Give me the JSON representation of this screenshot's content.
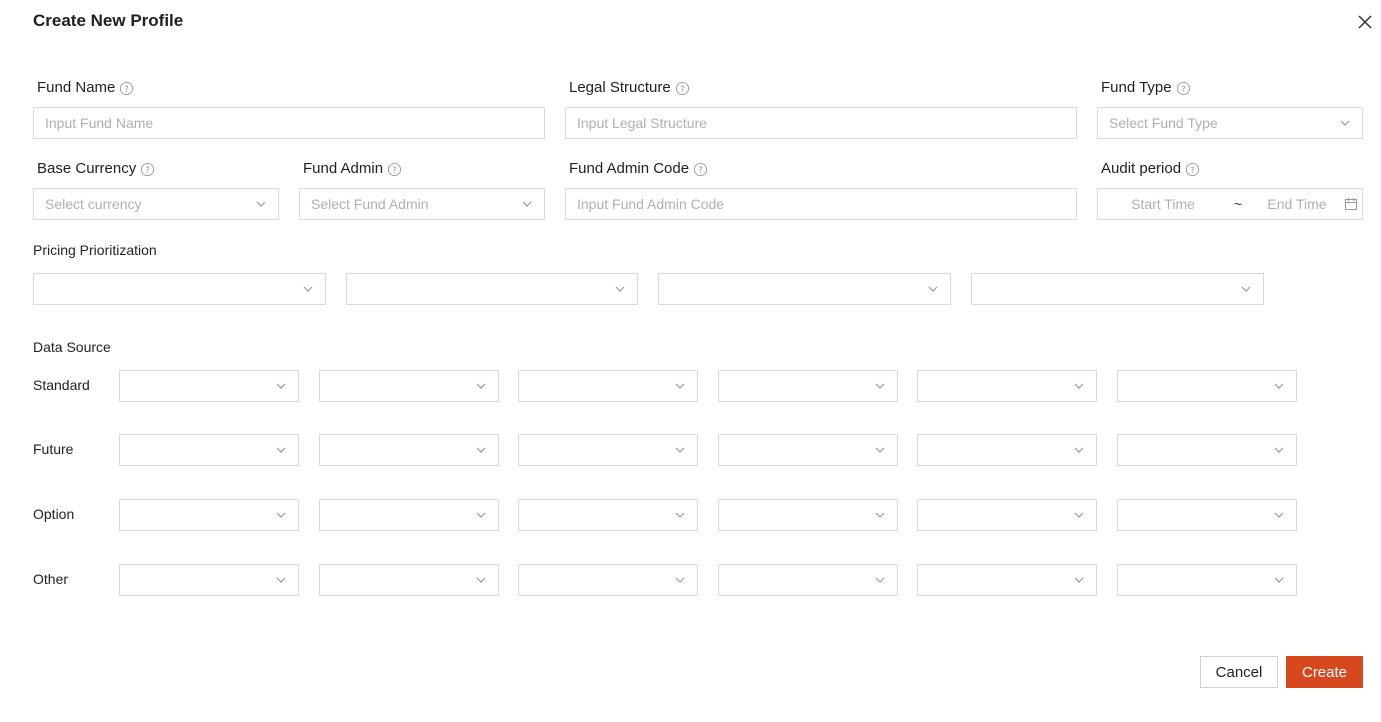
{
  "dialog": {
    "title": "Create New Profile"
  },
  "fields": {
    "fund_name": {
      "label": "Fund Name",
      "placeholder": "Input Fund Name"
    },
    "legal_structure": {
      "label": "Legal Structure",
      "placeholder": "Input Legal Structure"
    },
    "fund_type": {
      "label": "Fund Type",
      "placeholder": "Select Fund Type"
    },
    "base_currency": {
      "label": "Base Currency",
      "placeholder": "Select currency"
    },
    "fund_admin": {
      "label": "Fund Admin",
      "placeholder": "Select Fund Admin"
    },
    "fund_admin_code": {
      "label": "Fund Admin Code",
      "placeholder": "Input Fund Admin Code"
    },
    "audit_period": {
      "label": "Audit period",
      "start_placeholder": "Start Time",
      "separator": "~",
      "end_placeholder": "End Time"
    }
  },
  "pricing": {
    "label": "Pricing Prioritization"
  },
  "data_source": {
    "label": "Data Source",
    "rows": [
      "Standard",
      "Future",
      "Option",
      "Other"
    ]
  },
  "buttons": {
    "cancel": "Cancel",
    "create": "Create"
  },
  "colors": {
    "primary": "#d8481f",
    "border": "#d9d9d9",
    "placeholder": "#b0b0b0"
  },
  "icons": {
    "close": "close-icon",
    "help": "help-circle-icon",
    "chevron": "chevron-down-icon",
    "calendar": "calendar-icon"
  }
}
